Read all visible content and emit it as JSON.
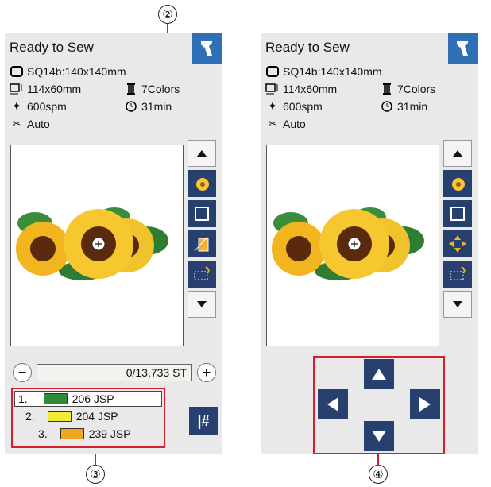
{
  "callouts": {
    "c2": "②",
    "c3": "③",
    "c4": "④"
  },
  "left_panel": {
    "title": "Ready to Sew",
    "hoop": "SQ14b:140x140mm",
    "size": "114x60mm",
    "colors_count": "7Colors",
    "speed": "600spm",
    "time": "31min",
    "thread_cut": "Auto",
    "stitch_counter": "0/13,733 ST",
    "minus": "−",
    "plus": "+",
    "jump_label": "|#",
    "colors": [
      {
        "num": "1.",
        "swatch": "#2e8b3a",
        "label": "206 JSP"
      },
      {
        "num": "2.",
        "swatch": "#f2ea3a",
        "label": "204 JSP"
      },
      {
        "num": "3.",
        "swatch": "#f2a523",
        "label": "239 JSP"
      }
    ]
  },
  "right_panel": {
    "title": "Ready to Sew",
    "hoop": "SQ14b:140x140mm",
    "size": "114x60mm",
    "colors_count": "7Colors",
    "speed": "600spm",
    "time": "31min",
    "thread_cut": "Auto"
  },
  "icons": {
    "back": "back-arrow-icon",
    "hoop": "hoop-icon",
    "size": "size-icon",
    "spool": "spool-icon",
    "runner": "speed-icon",
    "clock": "clock-icon",
    "scissors": "scissors-icon"
  },
  "theme": {
    "accent": "#2f6fb6",
    "button_dark": "#27406f",
    "highlight": "#d61f2a",
    "panel_bg": "#e9e9e9"
  }
}
